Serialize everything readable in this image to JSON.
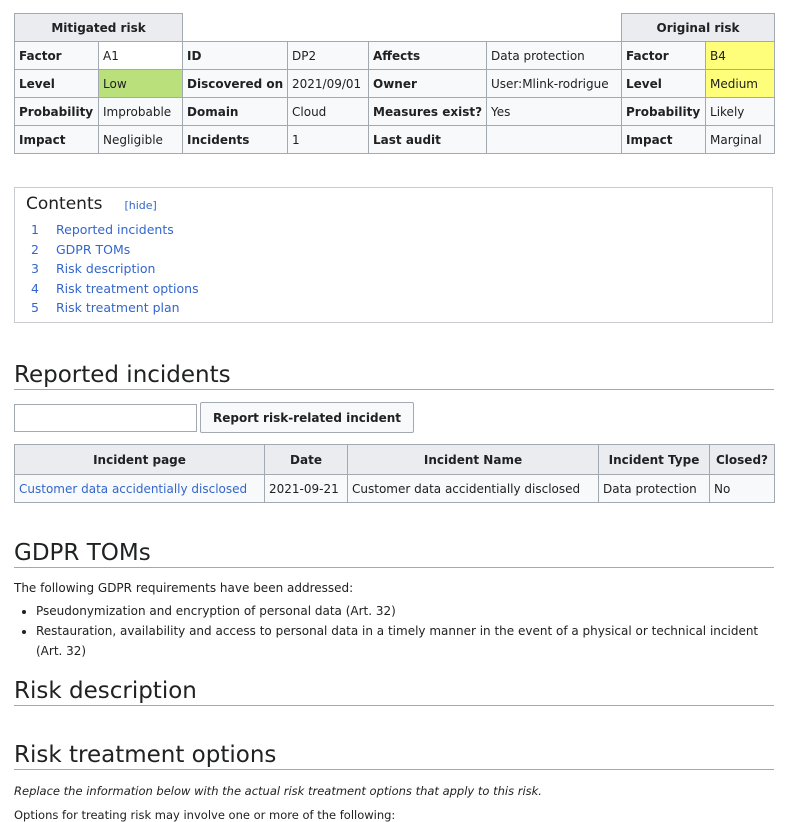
{
  "risk_table": {
    "mitigated_header": "Mitigated risk",
    "original_header": "Original risk",
    "rows": [
      {
        "l1": "Factor",
        "v1": "A1",
        "l2": "ID",
        "v2": "DP2",
        "l3": "Affects",
        "v3": "Data protection",
        "l4": "Factor",
        "v4": "B4"
      },
      {
        "l1": "Level",
        "v1": "Low",
        "l2": "Discovered on",
        "v2": "2021/09/01",
        "l3": "Owner",
        "v3": "User:Mlink-rodrigue",
        "l4": "Level",
        "v4": "Medium"
      },
      {
        "l1": "Probability",
        "v1": "Improbable",
        "l2": "Domain",
        "v2": "Cloud",
        "l3": "Measures exist?",
        "v3": "Yes",
        "l4": "Probability",
        "v4": "Likely"
      },
      {
        "l1": "Impact",
        "v1": "Negligible",
        "l2": "Incidents",
        "v2": "1",
        "l3": "Last audit",
        "v3": "",
        "l4": "Impact",
        "v4": "Marginal"
      }
    ],
    "colors": {
      "low": "#b9e07a",
      "medium": "#fefe7a"
    }
  },
  "toc": {
    "title": "Contents",
    "toggle": "[hide]",
    "items": [
      {
        "num": "1",
        "label": "Reported incidents"
      },
      {
        "num": "2",
        "label": "GDPR TOMs"
      },
      {
        "num": "3",
        "label": "Risk description"
      },
      {
        "num": "4",
        "label": "Risk treatment options"
      },
      {
        "num": "5",
        "label": "Risk treatment plan"
      }
    ]
  },
  "reported": {
    "heading": "Reported incidents",
    "input_value": "",
    "button": "Report risk-related incident",
    "columns": [
      "Incident page",
      "Date",
      "Incident Name",
      "Incident Type",
      "Closed?"
    ],
    "rows": [
      {
        "page": "Customer data accidentially disclosed",
        "date": "2021-09-21",
        "name": "Customer data accidentially disclosed",
        "type": "Data protection",
        "closed": "No"
      }
    ]
  },
  "gdpr": {
    "heading": "GDPR TOMs",
    "intro": "The following GDPR requirements have been addressed:",
    "items": [
      "Pseudonymization and encryption of personal data (Art. 32)",
      "Restauration, availability and access to personal data in a timely manner in the event of a physical or technical incident (Art. 32)"
    ]
  },
  "risk_description": {
    "heading": "Risk description"
  },
  "risk_treatment": {
    "heading": "Risk treatment options",
    "note": "Replace the information below with the actual risk treatment options that apply to this risk.",
    "partial": "Options for treating risk may involve one or more of the following:"
  }
}
